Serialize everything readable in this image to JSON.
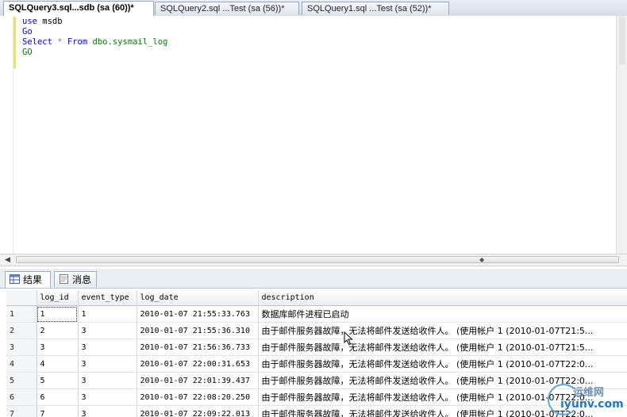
{
  "tabs": [
    {
      "label": "SQLQuery3.sql...sdb (sa (60))*",
      "active": true
    },
    {
      "label": "SQLQuery2.sql ...Test (sa (56))*",
      "active": false
    },
    {
      "label": "SQLQuery1.sql ...Test (sa (52))*",
      "active": false
    }
  ],
  "editor": {
    "lines": [
      {
        "kw": "use",
        "rest": " msdb"
      },
      {
        "kw": "Go",
        "rest": ""
      },
      {
        "kw": "Select",
        "op": " * ",
        "kw2": "From",
        "obj": " dbo.sysmail_log"
      },
      {
        "kw": "GO",
        "rest": ""
      }
    ]
  },
  "results": {
    "tab_results": "结果",
    "tab_messages": "消息",
    "columns": [
      "log_id",
      "event_type",
      "log_date",
      "description"
    ],
    "rows": [
      {
        "n": "1",
        "log_id": "1",
        "event_type": "1",
        "log_date": "2010-01-07 21:55:33.763",
        "description": "数据库邮件进程已启动"
      },
      {
        "n": "2",
        "log_id": "2",
        "event_type": "3",
        "log_date": "2010-01-07 21:55:36.310",
        "description": "由于邮件服务器故障，无法将邮件发送给收件人。 (使用帐户 1 (2010-01-07T21:5..."
      },
      {
        "n": "3",
        "log_id": "3",
        "event_type": "3",
        "log_date": "2010-01-07 21:56:36.733",
        "description": "由于邮件服务器故障，无法将邮件发送给收件人。 (使用帐户 1 (2010-01-07T21:5..."
      },
      {
        "n": "4",
        "log_id": "4",
        "event_type": "3",
        "log_date": "2010-01-07 22:00:31.653",
        "description": "由于邮件服务器故障，无法将邮件发送给收件人。 (使用帐户 1 (2010-01-07T22:0..."
      },
      {
        "n": "5",
        "log_id": "5",
        "event_type": "3",
        "log_date": "2010-01-07 22:01:39.437",
        "description": "由于邮件服务器故障，无法将邮件发送给收件人。 (使用帐户 1 (2010-01-07T22:0..."
      },
      {
        "n": "6",
        "log_id": "6",
        "event_type": "3",
        "log_date": "2010-01-07 22:08:20.250",
        "description": "由于邮件服务器故障，无法将邮件发送给收件人。 (使用帐户 1 (2010-01-07T22:0..."
      },
      {
        "n": "7",
        "log_id": "7",
        "event_type": "3",
        "log_date": "2010-01-07 22:09:22.013",
        "description": "由于邮件服务器故障，无法将邮件发送给收件人。 (使用帐户 1 (2010-01-07T22:0..."
      }
    ]
  },
  "watermark": {
    "line1": "运维网",
    "line2": "iyunv.com"
  }
}
